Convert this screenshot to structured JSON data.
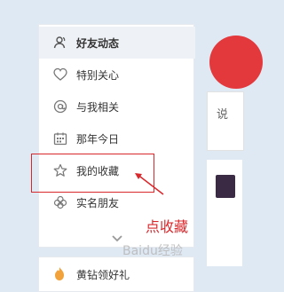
{
  "sidebar": {
    "items": [
      {
        "label": "好友动态",
        "icon": "friends-icon",
        "active": true
      },
      {
        "label": "特别关心",
        "icon": "heart-icon",
        "active": false
      },
      {
        "label": "与我相关",
        "icon": "at-icon",
        "active": false
      },
      {
        "label": "那年今日",
        "icon": "calendar-icon",
        "active": false
      },
      {
        "label": "我的收藏",
        "icon": "star-icon",
        "active": false
      },
      {
        "label": "实名朋友",
        "icon": "clover-icon",
        "active": false
      }
    ],
    "more_icon": "chevron-down-icon"
  },
  "bottom_panel": {
    "label": "黄钻领好礼",
    "icon": "flame-icon"
  },
  "right_card": {
    "text": "说"
  },
  "annotation": {
    "text": "点收藏",
    "color": "#d9282c"
  },
  "watermark": {
    "text": "Baidu经验"
  }
}
